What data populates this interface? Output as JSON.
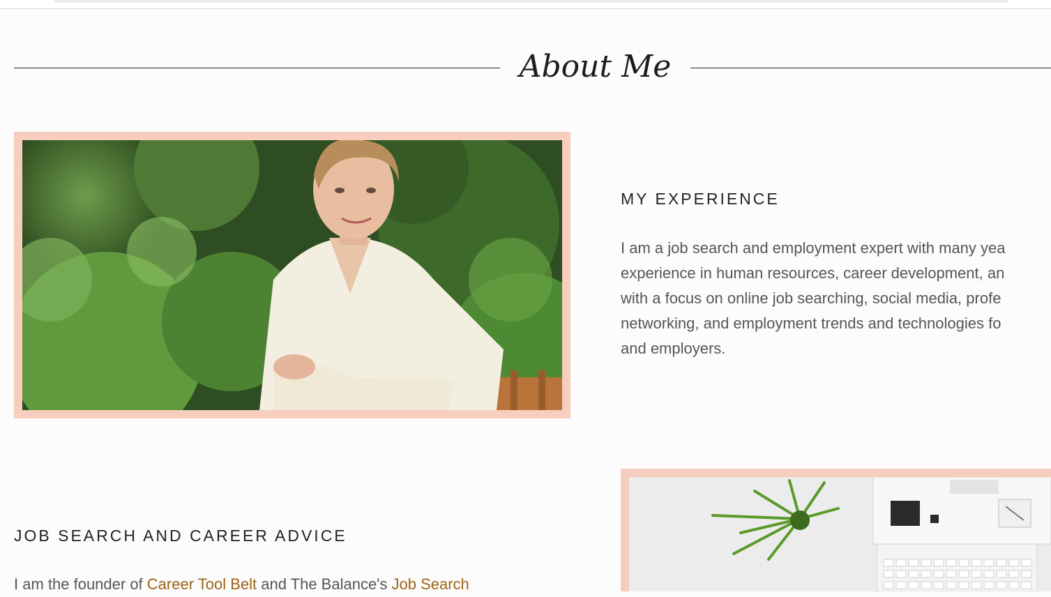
{
  "section_heading": "About Me",
  "experience": {
    "title": "MY EXPERIENCE",
    "lines": [
      "I am a job search and employment expert with many yea",
      "experience in human resources, career development, an",
      "with a focus on online job searching, social media, profe",
      "networking, and employment trends and technologies fo",
      "and employers."
    ]
  },
  "job_search": {
    "title": "JOB SEARCH AND CAREER ADVICE",
    "text_1": "I am the founder of ",
    "link_1": "Career Tool Belt",
    "text_2": " and The Balance's ",
    "link_2": "Job Search"
  },
  "colors": {
    "frame": "#f7cdbd",
    "link": "#9c6418",
    "body_text": "#555555",
    "heading_text": "#222222"
  },
  "images": {
    "portrait": "portrait-photo",
    "desk": "desk-laptop-plant-photo"
  }
}
